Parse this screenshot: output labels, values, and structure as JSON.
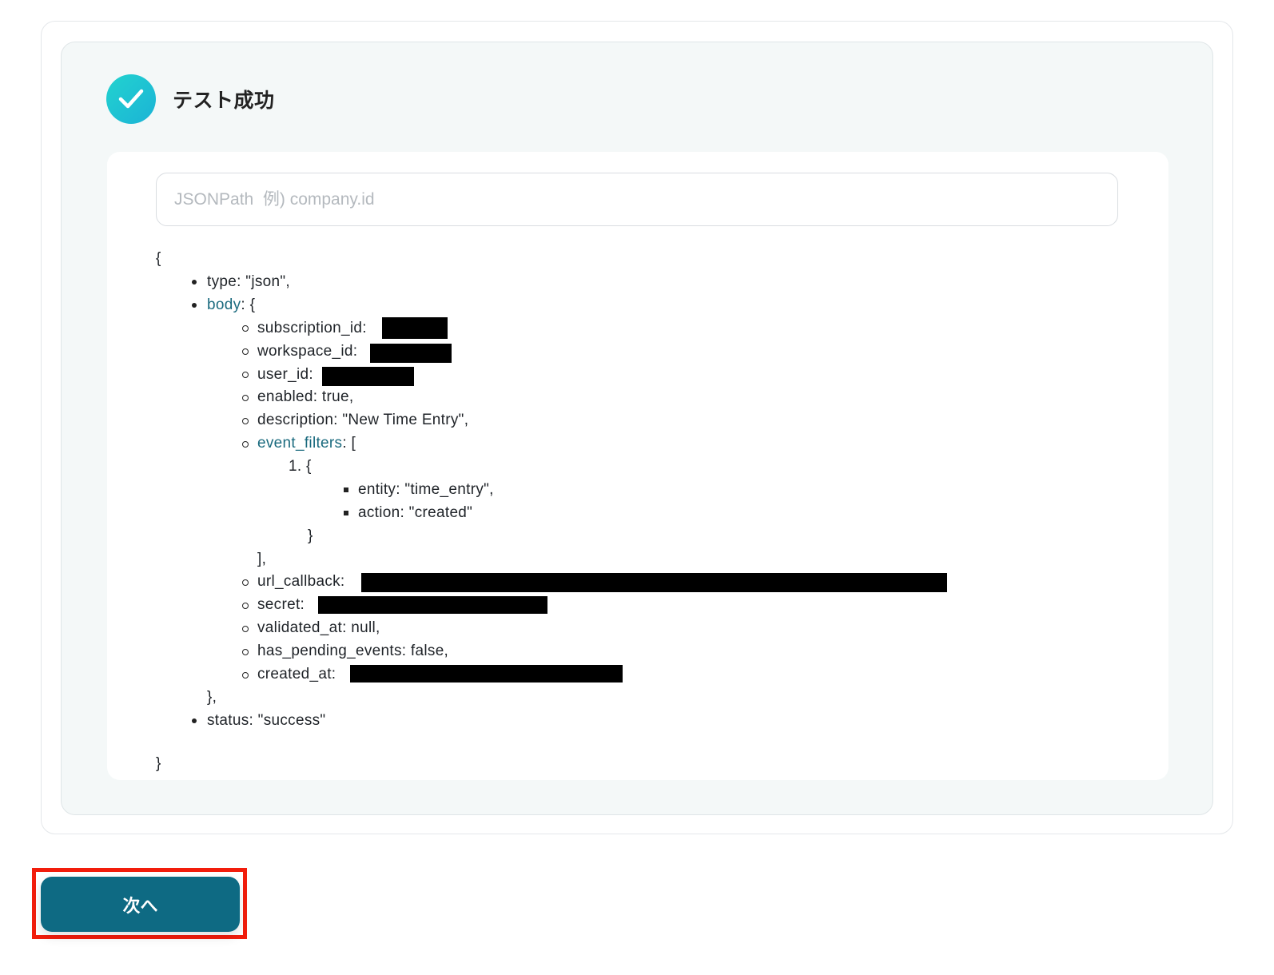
{
  "result": {
    "title": "テスト成功",
    "icon": "check-circle-icon",
    "accent_color": "#1ec4d4"
  },
  "jsonpath": {
    "placeholder": "JSONPath  例) company.id",
    "value": ""
  },
  "json_tree": {
    "open_brace": "{",
    "close_brace": "}",
    "type_line": "type: \"json\",",
    "body_key": "body",
    "body_open": ": {",
    "subscription_id": "subscription_id:",
    "workspace_id": "workspace_id:",
    "user_id": "user_id:",
    "enabled": "enabled: true,",
    "description": "description: \"New Time Entry\",",
    "event_filters_key": "event_filters",
    "event_filters_open": ": [",
    "item_index": "1. {",
    "entity": "entity: \"time_entry\",",
    "action": "action: \"created\"",
    "item_close": "}",
    "array_close": "],",
    "url_callback": "url_callback:",
    "secret": "secret:",
    "validated_at": "validated_at: null,",
    "has_pending_events": "has_pending_events: false,",
    "created_at": "created_at:",
    "body_close": "},",
    "status_line": "status: \"success\""
  },
  "footer": {
    "next_label": "次へ",
    "button_color": "#0e6a83",
    "highlight_color": "#f21d0c"
  }
}
